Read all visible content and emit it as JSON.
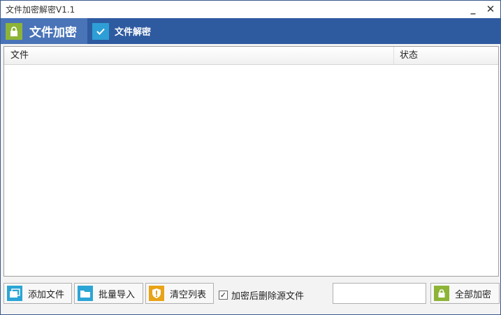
{
  "window": {
    "title": "文件加密解密V1.1",
    "minimize_glyph": "_",
    "close_glyph": "✕"
  },
  "tabs": [
    {
      "label": "文件加密",
      "icon": "lock-icon",
      "active": true
    },
    {
      "label": "文件解密",
      "icon": "check-icon",
      "active": false
    }
  ],
  "list": {
    "columns": [
      "文件",
      "状态"
    ],
    "rows": []
  },
  "toolbar": {
    "add_files": {
      "label": "添加文件",
      "icon": "folder-files-icon"
    },
    "batch_import": {
      "label": "批量导入",
      "icon": "folder-icon"
    },
    "clear_list": {
      "label": "清空列表",
      "icon": "warning-shield-icon"
    },
    "delete_after": {
      "label": "加密后删除源文件",
      "checked": true
    },
    "password": {
      "value": "",
      "placeholder": ""
    },
    "encrypt_all": {
      "label": "全部加密",
      "icon": "lock-icon"
    }
  },
  "colors": {
    "tab_bar": "#2e5aa0",
    "active_tab": "#4a74b8",
    "lock_green": "#8db437",
    "check_blue": "#2e9ed6",
    "folder_blue": "#2ba5d5",
    "warning_orange": "#e8a317"
  }
}
